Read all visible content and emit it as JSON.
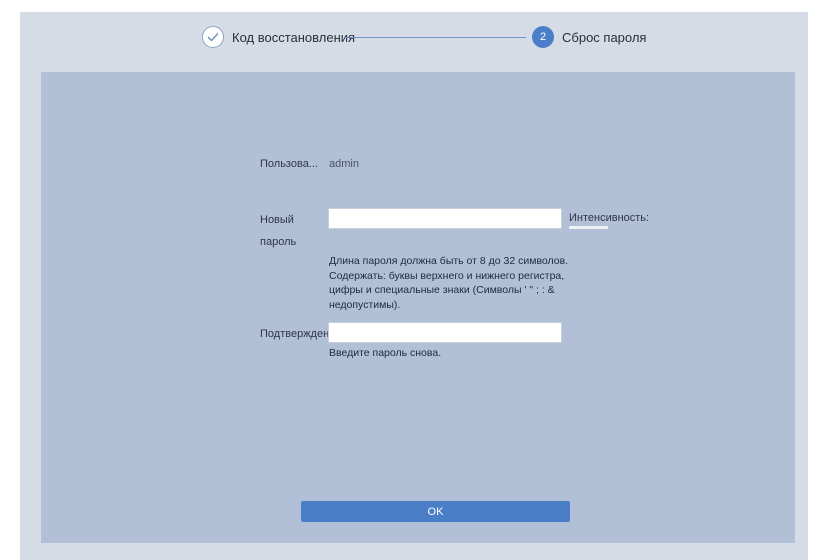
{
  "stepper": {
    "step1": {
      "label": "Код восстановления",
      "state": "done"
    },
    "step2": {
      "label": "Сброс пароля",
      "number": "2",
      "state": "active"
    }
  },
  "form": {
    "username": {
      "label": "Пользова...",
      "value": "admin"
    },
    "new_password": {
      "label_line1": "Новый",
      "label_line2": "пароль",
      "value": "",
      "strength_label": "Интенсивность:",
      "hint": "Длина пароля должна быть от 8 до 32 символов. Содержать: буквы верхнего и нижнего регистра, цифры и специальные знаки (Символы ' \" ; : & недопустимы)."
    },
    "confirm": {
      "label": "Подтвержден",
      "value": "",
      "hint": "Введите пароль снова."
    },
    "ok_label": "OK"
  },
  "colors": {
    "accent": "#4a7fc8",
    "panel": "#b1c0d7",
    "window": "#d5dce6"
  }
}
